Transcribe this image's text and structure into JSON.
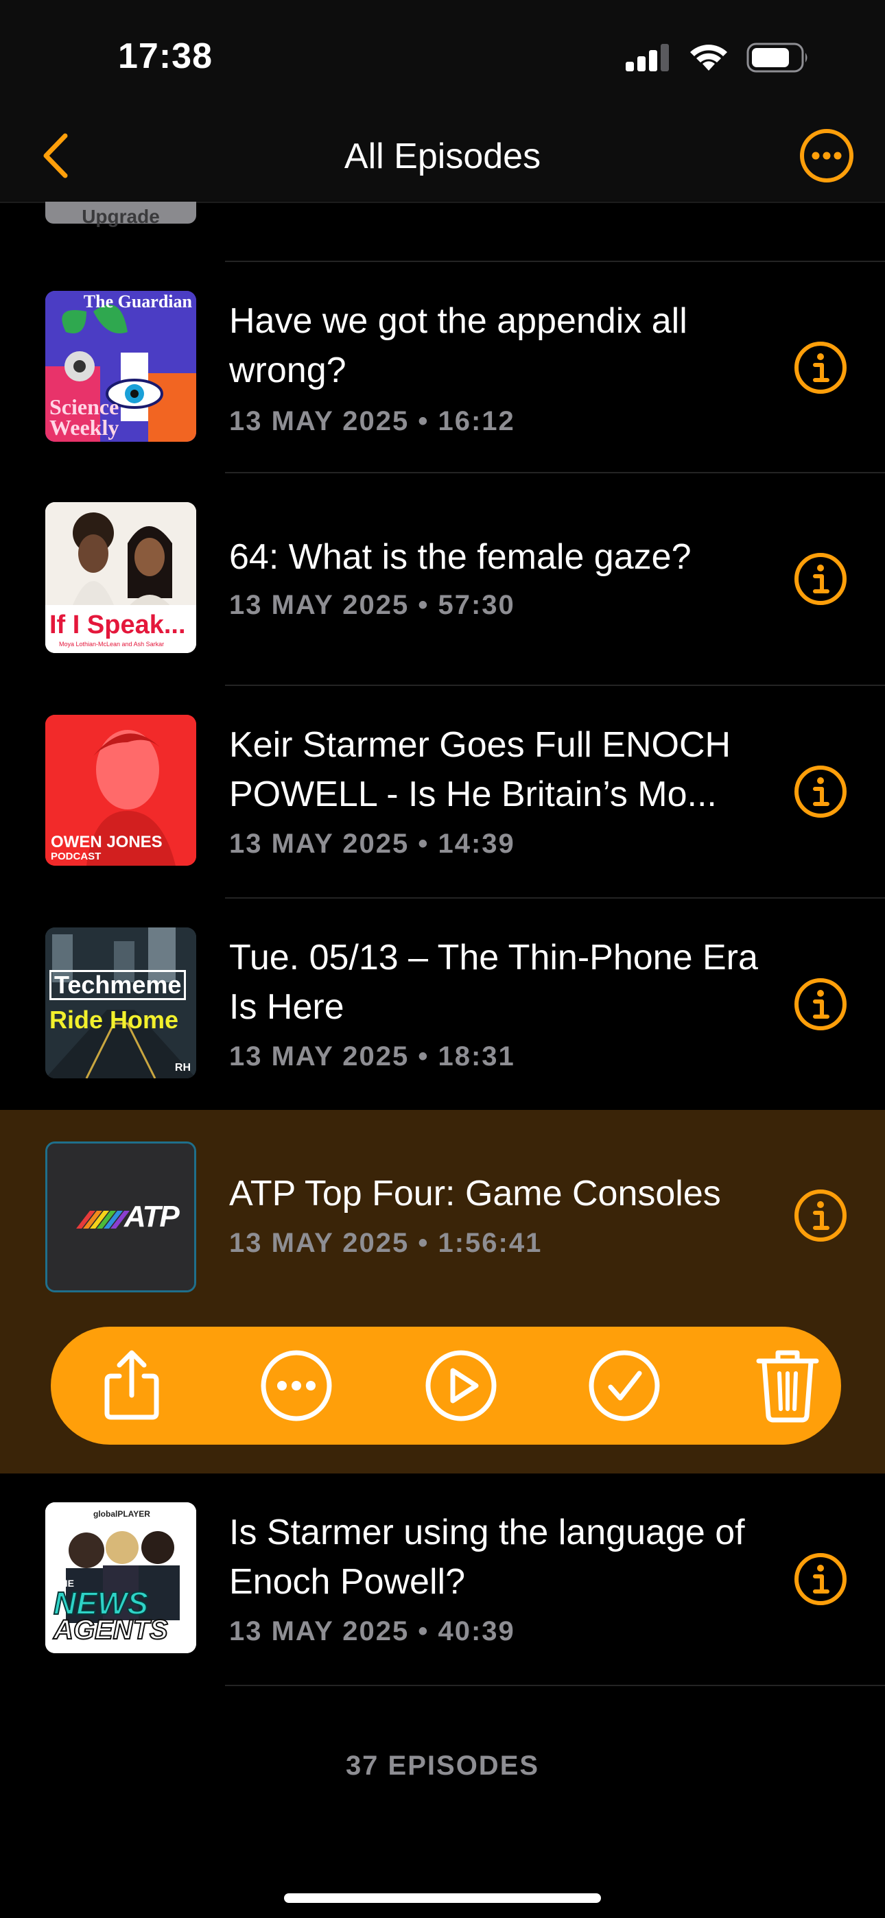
{
  "status_bar": {
    "time": "17:38"
  },
  "nav": {
    "title": "All Episodes",
    "back_icon": "chevron-left-icon",
    "more_icon": "ellipsis-circle-icon"
  },
  "cutoff_item": {
    "art_text": "Upgrade"
  },
  "episodes": [
    {
      "title": "Have we got the appendix all wrong?",
      "date": "13 MAY 2025",
      "duration": "16:12",
      "art": {
        "text_top": "The Guardian",
        "text_bottom": "Science Weekly"
      }
    },
    {
      "title": "64: What is the female gaze?",
      "date": "13 MAY 2025",
      "duration": "57:30",
      "art": {
        "text": "If I Speak...",
        "subtext": "Moya Lothian-McLean and Ash Sarkar"
      }
    },
    {
      "title": "Keir Starmer Goes Full ENOCH POWELL - Is He Britain’s Mo...",
      "date": "13 MAY 2025",
      "duration": "14:39",
      "art": {
        "text": "OWEN JONES",
        "subtext": "PODCAST"
      }
    },
    {
      "title": "Tue. 05/13 – The Thin-Phone Era Is Here",
      "date": "13 MAY 2025",
      "duration": "18:31",
      "art": {
        "text_top": "Techmeme",
        "text_bottom": "Ride Home",
        "corner": "RH"
      }
    },
    {
      "title": "ATP Top Four: Game Consoles",
      "date": "13 MAY 2025",
      "duration": "1:56:41",
      "art": {
        "text": "ATP"
      },
      "selected": true
    },
    {
      "title": "Is Starmer using the language of Enoch Powell?",
      "date": "13 MAY 2025",
      "duration": "40:39",
      "art": {
        "text_top": "globalPLAYER",
        "text_mid": "THE",
        "text_a": "NEWS",
        "text_b": "AGENTS"
      }
    }
  ],
  "meta_separator": "•",
  "actions": [
    {
      "name": "share",
      "icon": "share-icon"
    },
    {
      "name": "more",
      "icon": "ellipsis-circle-icon"
    },
    {
      "name": "play",
      "icon": "play-circle-icon"
    },
    {
      "name": "mark-played",
      "icon": "checkmark-circle-icon"
    },
    {
      "name": "delete",
      "icon": "trash-icon"
    }
  ],
  "footer": {
    "count_label": "37 EPISODES"
  },
  "colors": {
    "accent": "#ff9f0a",
    "selected_row": "#3a2408",
    "meta": "#8e8e93"
  }
}
